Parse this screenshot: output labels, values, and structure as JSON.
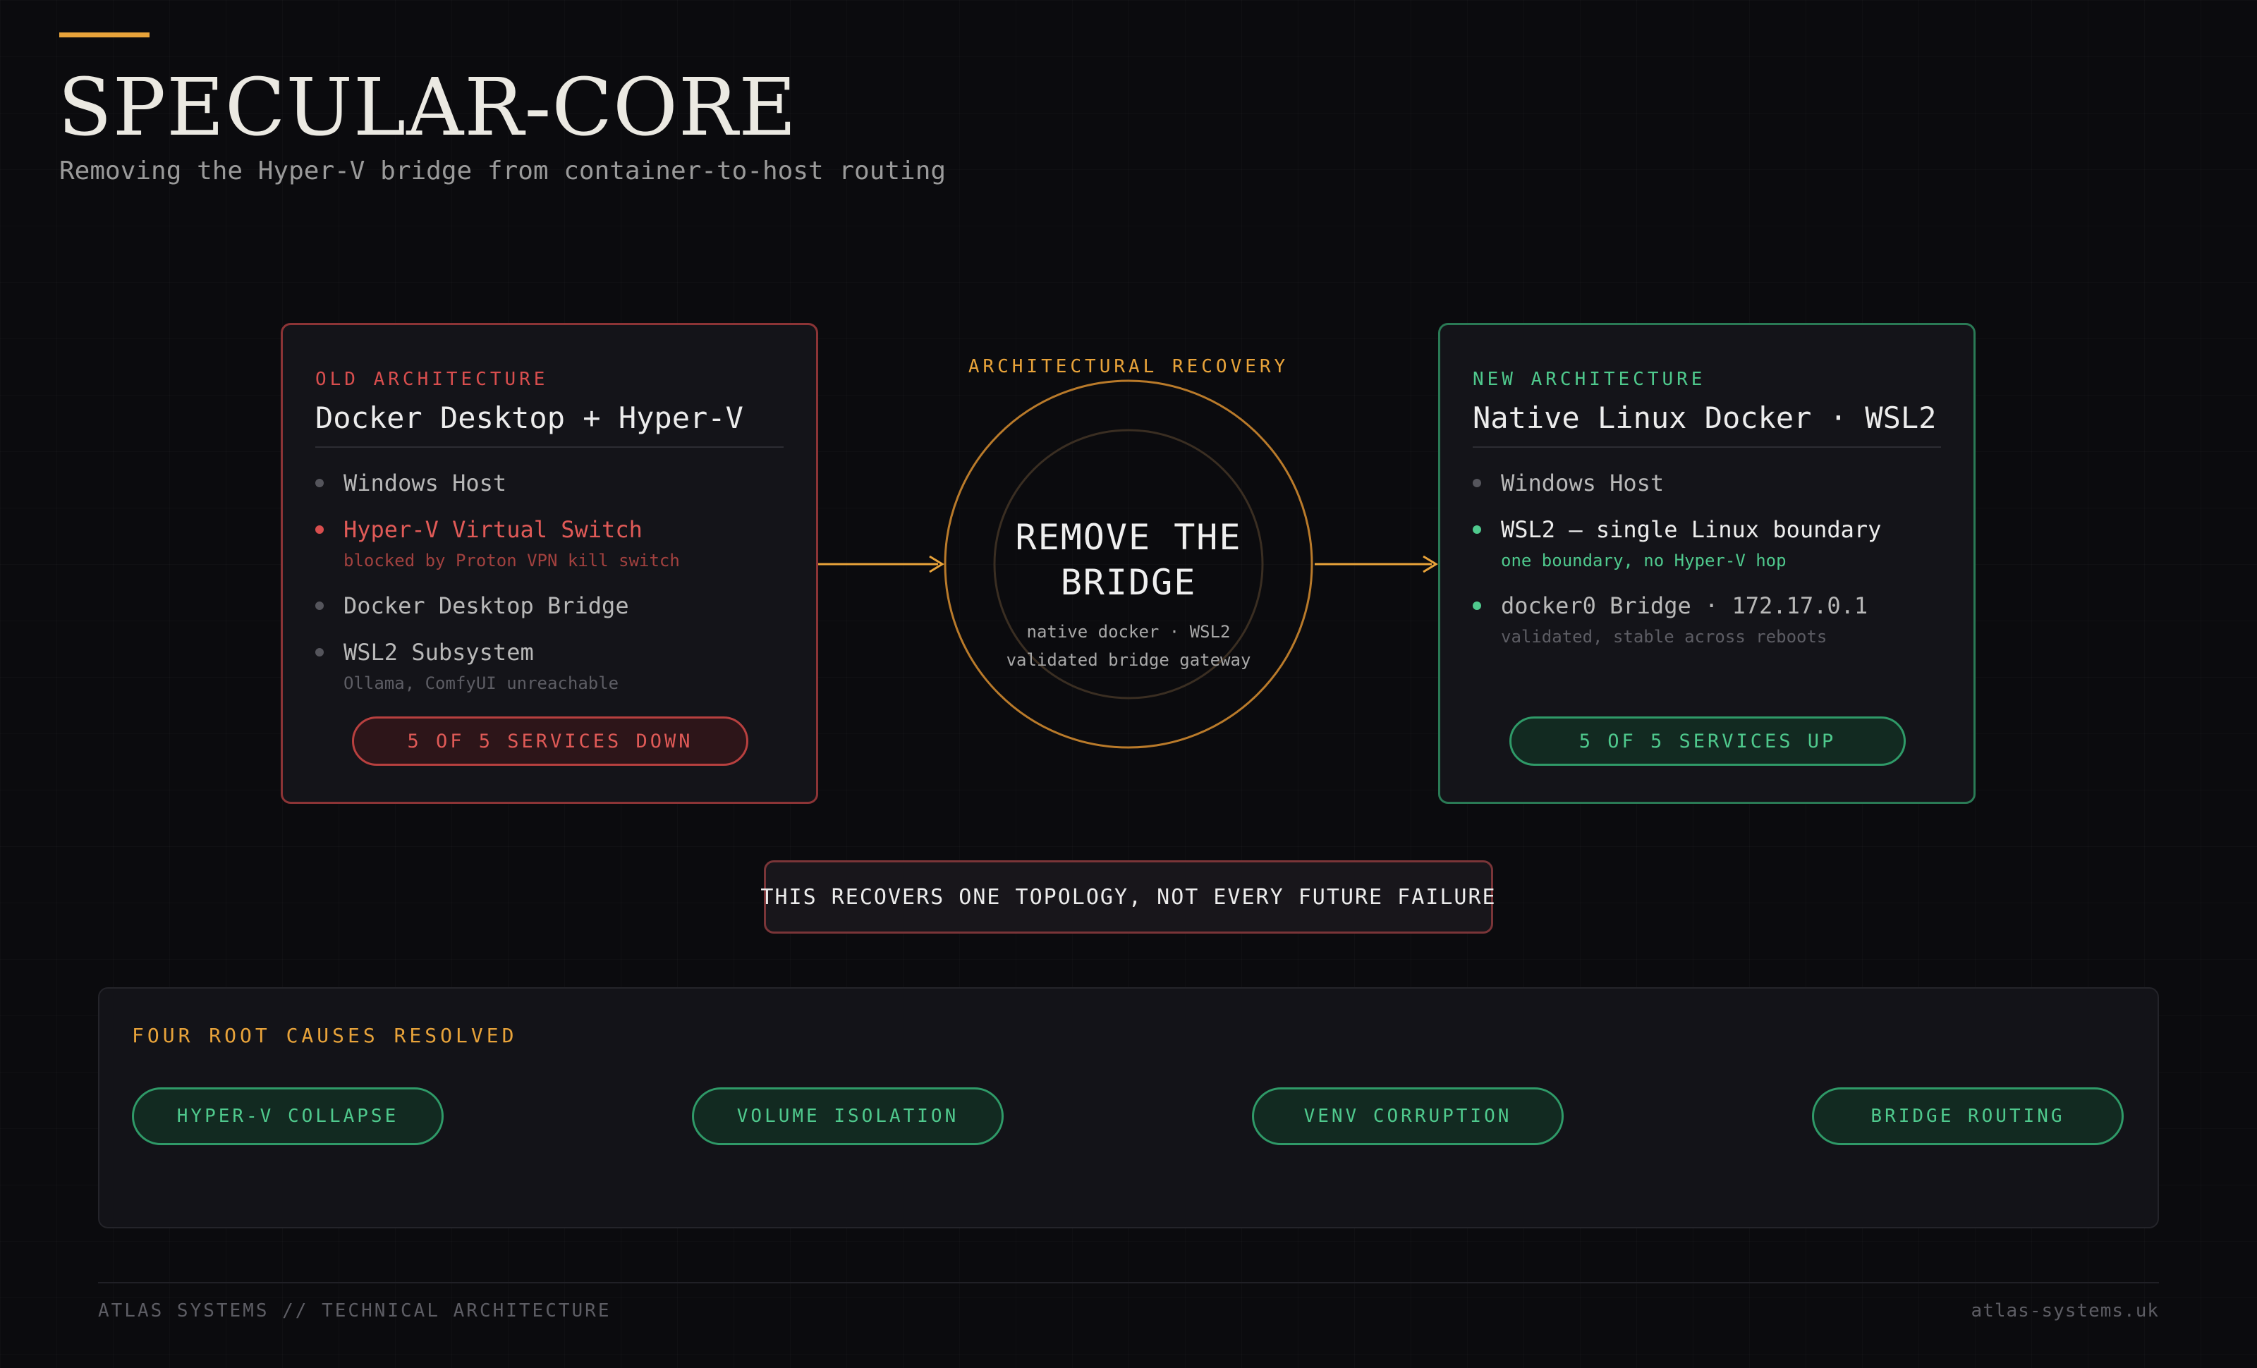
{
  "header": {
    "title": "SPECULAR-CORE",
    "subtitle": "Removing the Hyper-V bridge from container-to-host routing"
  },
  "old_card": {
    "kicker": "OLD ARCHITECTURE",
    "heading": "Docker Desktop + Hyper-V",
    "items": [
      {
        "label": "Windows Host",
        "note": ""
      },
      {
        "label": "Hyper-V Virtual Switch",
        "note": "blocked by Proton VPN kill switch"
      },
      {
        "label": "Docker Desktop Bridge",
        "note": ""
      },
      {
        "label": "WSL2 Subsystem",
        "note": "Ollama, ComfyUI unreachable"
      }
    ],
    "status": "5 OF 5 SERVICES DOWN"
  },
  "center": {
    "kicker": "ARCHITECTURAL RECOVERY",
    "title_line1": "REMOVE THE",
    "title_line2": "BRIDGE",
    "sub_line1": "native docker · WSL2",
    "sub_line2": "validated bridge gateway"
  },
  "new_card": {
    "kicker": "NEW ARCHITECTURE",
    "heading": "Native Linux Docker · WSL2",
    "items": [
      {
        "label": "Windows Host",
        "note": ""
      },
      {
        "label": "WSL2 — single Linux boundary",
        "note": "one boundary, no Hyper-V hop"
      },
      {
        "label": "docker0 Bridge · 172.17.0.1",
        "note": "validated, stable across reboots"
      }
    ],
    "status": "5 OF 5 SERVICES UP"
  },
  "caveat": "THIS RECOVERS ONE TOPOLOGY, NOT EVERY FUTURE FAILURE",
  "root_causes": {
    "kicker": "FOUR ROOT CAUSES RESOLVED",
    "items": [
      "HYPER-V COLLAPSE",
      "VOLUME ISOLATION",
      "VENV CORRUPTION",
      "BRIDGE ROUTING"
    ]
  },
  "footer": {
    "left": "ATLAS SYSTEMS // TECHNICAL ARCHITECTURE",
    "right": "atlas-systems.uk"
  },
  "colors": {
    "accent": "#e8a33a",
    "danger": "#d84e4e",
    "success": "#4fc98d",
    "background": "#0b0b0e"
  }
}
